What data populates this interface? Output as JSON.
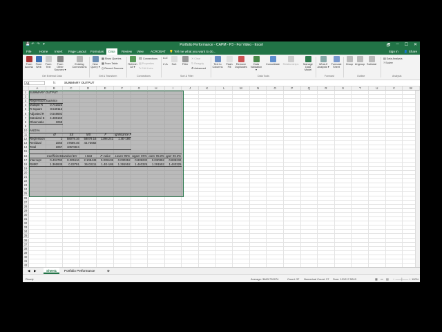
{
  "titlebar": {
    "title": "Portfolio Performance - CAPM - P3 - For Video - Excel",
    "qat": [
      "💾",
      "↶",
      "↷",
      "▾"
    ],
    "controls": [
      "🗗",
      "─",
      "☐",
      "✕"
    ]
  },
  "tabs": [
    "File",
    "Home",
    "Insert",
    "Page Layout",
    "Formulas",
    "Data",
    "Review",
    "View",
    "ACROBAT"
  ],
  "active_tab": "Data",
  "tell_me": "Tell me what you want to do...",
  "sign_in": "Sign in",
  "share": "Share",
  "ribbon": {
    "get_external": {
      "label": "Get External Data",
      "buttons": [
        "From Access",
        "From Web",
        "From Text",
        "From Other Sources ▾",
        "Existing Connections"
      ]
    },
    "get_transform": {
      "label": "Get & Transform",
      "new_query": "New Query ▾",
      "small": [
        "Show Queries",
        "From Table",
        "Recent Sources"
      ]
    },
    "connections": {
      "label": "Connections",
      "refresh": "Refresh All ▾",
      "small": [
        "Connections",
        "Properties",
        "Edit Links"
      ]
    },
    "sort_filter": {
      "label": "Sort & Filter",
      "sort": "Sort",
      "filter": "Filter",
      "small": [
        "Clear",
        "Reapply",
        "Advanced"
      ]
    },
    "data_tools": {
      "label": "Data Tools",
      "buttons": [
        "Text to Columns",
        "Flash Fill",
        "Remove Duplicates",
        "Data Validation ▾",
        "Consolidate",
        "Relationships",
        "Manage Data Model"
      ]
    },
    "forecast": {
      "label": "Forecast",
      "buttons": [
        "What-If Analysis ▾",
        "Forecast Sheet"
      ]
    },
    "outline": {
      "label": "Outline",
      "buttons": [
        "Group",
        "Ungroup",
        "Subtotal"
      ]
    },
    "analysis": {
      "label": "Analysis",
      "small": [
        "Data Analysis",
        "Solver"
      ]
    }
  },
  "formula_bar": {
    "name_box": "A1",
    "fx": "fx",
    "content": "SUMMARY OUTPUT"
  },
  "columns": [
    "A",
    "B",
    "C",
    "D",
    "E",
    "F",
    "G",
    "H",
    "I",
    "J",
    "K",
    "L",
    "M",
    "N",
    "O",
    "P",
    "Q",
    "R",
    "S",
    "T",
    "U",
    "V",
    "W"
  ],
  "rows": [
    "1",
    "2",
    "3",
    "4",
    "5",
    "6",
    "7",
    "8",
    "9",
    "10",
    "11",
    "12",
    "13",
    "14",
    "15",
    "16",
    "17",
    "18",
    "19",
    "20",
    "21",
    "22",
    "23",
    "24",
    "25",
    "26",
    "27",
    "28",
    "29",
    "30",
    "31",
    "32",
    "33",
    "34",
    "35",
    "36",
    "37",
    "38",
    "39",
    "40",
    "41",
    "42"
  ],
  "cells": {
    "r1": "SUMMARY OUTPUT",
    "reg_stats": "Regression Statistics",
    "multiple_r": [
      "Multiple R",
      "0.741023"
    ],
    "r_square": [
      "R Square",
      "0.549115"
    ],
    "adj_r_square": [
      "Adjusted R",
      "0.548692"
    ],
    "std_error": [
      "Standard E",
      "4.488159"
    ],
    "observations": [
      "Observatio",
      "1068"
    ],
    "anova": "ANOVA",
    "anova_header": [
      "df",
      "SS",
      "MS",
      "F",
      "ignificance F"
    ],
    "regression": [
      "Regression",
      "1",
      "58079.16",
      "58079.16",
      "1298.241",
      "1.4E-186"
    ],
    "residual": [
      "Residual",
      "1066",
      "47689.45",
      "44.73682"
    ],
    "total": [
      "Total",
      "1067",
      "105768.6"
    ],
    "coef_header": [
      "Coefficientstandard Err",
      "t Stat",
      "P-value",
      "Lower 95%",
      "Upper 95%",
      "ower 95.0%",
      "pper 95.0%"
    ],
    "intercept": [
      "Intercept",
      "0.434792",
      "0.205116",
      "2.108449",
      "0.035136",
      "0.030352",
      "0.839232",
      "0.030352",
      "0.839232"
    ],
    "rmrf": [
      "RMRF",
      "1.365938",
      "0.03791",
      "36.03111",
      "1.4E-186",
      "1.291552",
      "1.440325",
      "1.291552",
      "1.440325"
    ]
  },
  "sheet_tabs": [
    "Sheet1",
    "Portfolio Performance"
  ],
  "active_sheet": "Sheet1",
  "status": {
    "ready": "Ready",
    "average": "Average: 3663.720074",
    "count": "Count: 37",
    "numerical_count": "Numerical Count: 37",
    "sum": "Sum: 121217.5243",
    "zoom": "100%"
  }
}
